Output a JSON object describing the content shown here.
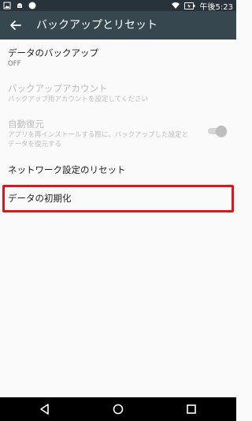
{
  "status_bar": {
    "time": "午後5:23",
    "icons": [
      "image-icon",
      "android-icon",
      "circle-icon",
      "wifi-icon",
      "battery-icon"
    ]
  },
  "toolbar": {
    "title": "バックアップとリセット",
    "back_icon": "back-arrow-icon"
  },
  "settings": [
    {
      "title": "データのバックアップ",
      "subtitle": "OFF",
      "enabled": true
    },
    {
      "title": "バックアップアカウント",
      "subtitle": "バックアップ用アカウントを設定してください",
      "enabled": false
    },
    {
      "title": "自動復元",
      "subtitle_lines": [
        "アプリを再インストールする際に、バックアップした設定と",
        "データを復元する"
      ],
      "enabled": false,
      "toggle": "off"
    },
    {
      "title": "ネットワーク設定のリセット",
      "enabled": true
    },
    {
      "title": "データの初期化",
      "enabled": true,
      "highlighted": true
    }
  ],
  "nav_bar": {
    "buttons": [
      "back-triangle-icon",
      "home-circle-icon",
      "recents-square-icon"
    ]
  },
  "colors": {
    "status_bar": "#27323a",
    "toolbar": "#37474f",
    "background": "#fafafa",
    "highlight": "#e0141b",
    "disabled_text": "#bdbdbd"
  }
}
